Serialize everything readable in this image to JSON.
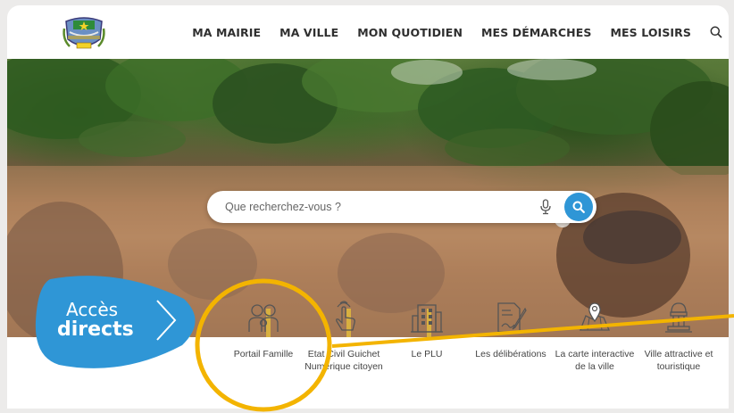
{
  "header": {
    "nav": [
      "MA MAIRIE",
      "MA VILLE",
      "MON QUOTIDIEN",
      "MES DÉMARCHES",
      "MES LOISIRS"
    ]
  },
  "search": {
    "placeholder": "Que recherchez-vous ?"
  },
  "acces": {
    "line1": "Accès",
    "line2": "directs"
  },
  "tiles": [
    {
      "label": "Portail Famille",
      "icon": "family-icon"
    },
    {
      "label": "Etat Civil Guichet Numérique citoyen",
      "icon": "touch-hand-icon"
    },
    {
      "label": "Le PLU",
      "icon": "building-icon"
    },
    {
      "label": "Les délibérations",
      "icon": "document-pen-icon"
    },
    {
      "label": "La carte interactive de la ville",
      "icon": "map-pin-icon"
    },
    {
      "label": "Ville attractive et touristique",
      "icon": "monument-icon"
    }
  ],
  "colors": {
    "accent_blue": "#2f96d6",
    "highlight_yellow": "#f3b400",
    "nav_text": "#2f2f2f"
  }
}
